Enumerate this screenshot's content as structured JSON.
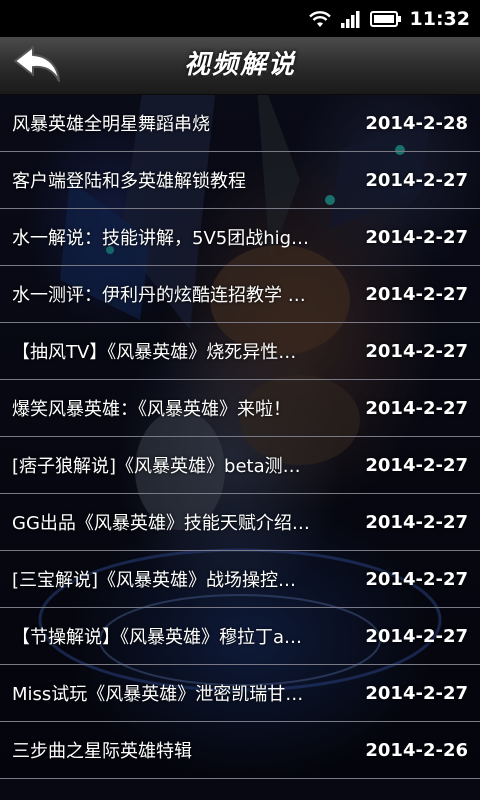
{
  "status_bar": {
    "time": "11:32",
    "icons": [
      "wifi-icon",
      "signal-icon",
      "battery-icon"
    ]
  },
  "header": {
    "title": "视频解说",
    "back_icon": "back-arrow-icon"
  },
  "videos": [
    {
      "title": "风暴英雄全明星舞蹈串烧",
      "date": "2014-2-28"
    },
    {
      "title": "客户端登陆和多英雄解锁教程",
      "date": "2014-2-27"
    },
    {
      "title": "水一解说：技能讲解，5V5团战hig…",
      "date": "2014-2-27"
    },
    {
      "title": "水一测评：伊利丹的炫酷连招教学 …",
      "date": "2014-2-27"
    },
    {
      "title": "【抽风TV】《风暴英雄》烧死异性…",
      "date": "2014-2-27"
    },
    {
      "title": "爆笑风暴英雄：《风暴英雄》来啦！",
      "date": "2014-2-27"
    },
    {
      "title": "[痞子狼解说]《风暴英雄》beta测…",
      "date": "2014-2-27"
    },
    {
      "title": "GG出品《风暴英雄》技能天赋介绍…",
      "date": "2014-2-27"
    },
    {
      "title": "[三宝解说]《风暴英雄》战场操控…",
      "date": "2014-2-27"
    },
    {
      "title": "【节操解说】《风暴英雄》穆拉丁a…",
      "date": "2014-2-27"
    },
    {
      "title": "Miss试玩《风暴英雄》泄密凯瑞甘…",
      "date": "2014-2-27"
    },
    {
      "title": "三步曲之星际英雄特辑",
      "date": "2014-2-26"
    }
  ]
}
